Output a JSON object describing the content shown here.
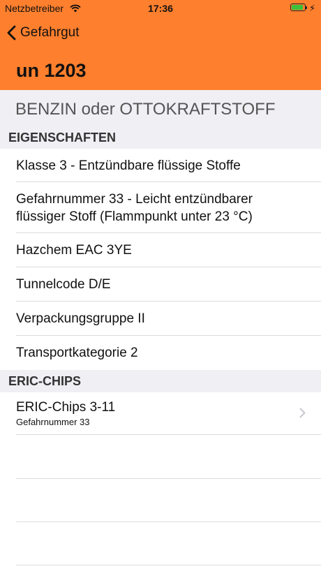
{
  "status_bar": {
    "carrier": "Netzbetreiber",
    "time": "17:36",
    "battery_level": 0.9
  },
  "nav": {
    "back_label": "Gefahrgut",
    "title": "un 1203"
  },
  "subtitle": "BENZIN oder OTTOKRAFTSTOFF",
  "sections": [
    {
      "header": "EIGENSCHAFTEN",
      "rows": [
        {
          "text": "Klasse 3 - Entzündbare flüssige Stoffe"
        },
        {
          "text_line1": "Gefahrnummer 33 - Leicht entzündbarer",
          "text_line2": "flüssiger Stoff (Flammpunkt unter 23 °C)"
        },
        {
          "text": "Hazchem EAC 3YE"
        },
        {
          "text": "Tunnelcode D/E"
        },
        {
          "text": "Verpackungsgruppe II"
        },
        {
          "text": "Transportkategorie 2"
        }
      ]
    },
    {
      "header": "ERIC-CHIPS",
      "rows": [
        {
          "title": "ERIC-Chips 3-11",
          "detail": "Gefahrnummer 33"
        }
      ]
    }
  ],
  "colors": {
    "accent": "#fe7f2d",
    "section_background": "#efeff4",
    "separator": "#dcdce0",
    "battery": "#3cc13c"
  },
  "icons": [
    "wifi-icon",
    "battery-icon",
    "charging-bolt-icon",
    "chevron-left-icon",
    "chevron-right-icon"
  ]
}
